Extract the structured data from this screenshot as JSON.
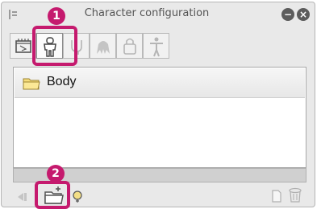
{
  "window": {
    "title": "Character configuration"
  },
  "titlebar": {
    "minimize_glyph": "−",
    "close_glyph": "×"
  },
  "tabs": [
    {
      "name": "animation-tab",
      "icon": "film-frame-icon"
    },
    {
      "name": "body-tab",
      "icon": "body-silhouette-icon",
      "active": true
    },
    {
      "name": "head-tab",
      "icon": "head-icon"
    },
    {
      "name": "hair-tab",
      "icon": "hair-icon"
    },
    {
      "name": "accessory-tab",
      "icon": "bag-icon"
    },
    {
      "name": "pose-tab",
      "icon": "standing-figure-icon"
    }
  ],
  "list": {
    "items": [
      {
        "label": "Body",
        "icon": "folder-icon"
      }
    ]
  },
  "toolbar": {
    "left_icons": [
      "move-left-icon",
      "add-folder-icon",
      "add-part-icon"
    ],
    "right_icons": [
      "new-item-icon",
      "delete-trash-icon"
    ]
  },
  "annotations": {
    "badge_1": "1",
    "badge_2": "2"
  },
  "colors": {
    "highlight": "#c51a6e",
    "panel_bg": "#e9e9e9"
  }
}
